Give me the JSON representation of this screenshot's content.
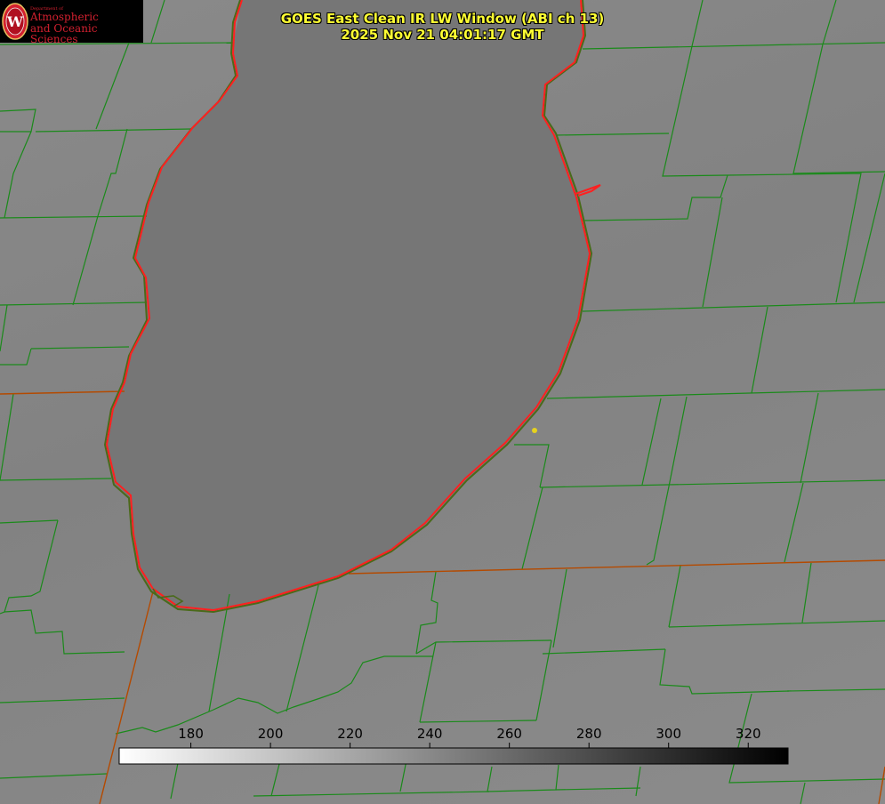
{
  "logo": {
    "department": "Department of",
    "line1": "Atmospheric",
    "line2": "and Oceanic Sciences",
    "seal_letter": "W"
  },
  "title": {
    "line1": "GOES East Clean IR LW Window (ABI ch 13)",
    "line2": "2025 Nov 21 04:01:17 GMT"
  },
  "colorbar": {
    "ticks": [
      "180",
      "200",
      "220",
      "240",
      "260",
      "280",
      "300",
      "320"
    ],
    "min_value": 162,
    "max_value": 330,
    "low_color": "#ffffff",
    "high_color": "#000000"
  },
  "colors": {
    "county_lines": "#1a8a1a",
    "lake_shore": "#ff2020",
    "state_lines": "#b44a00",
    "title_text": "#ffff33",
    "marker": "#e6d21e"
  }
}
